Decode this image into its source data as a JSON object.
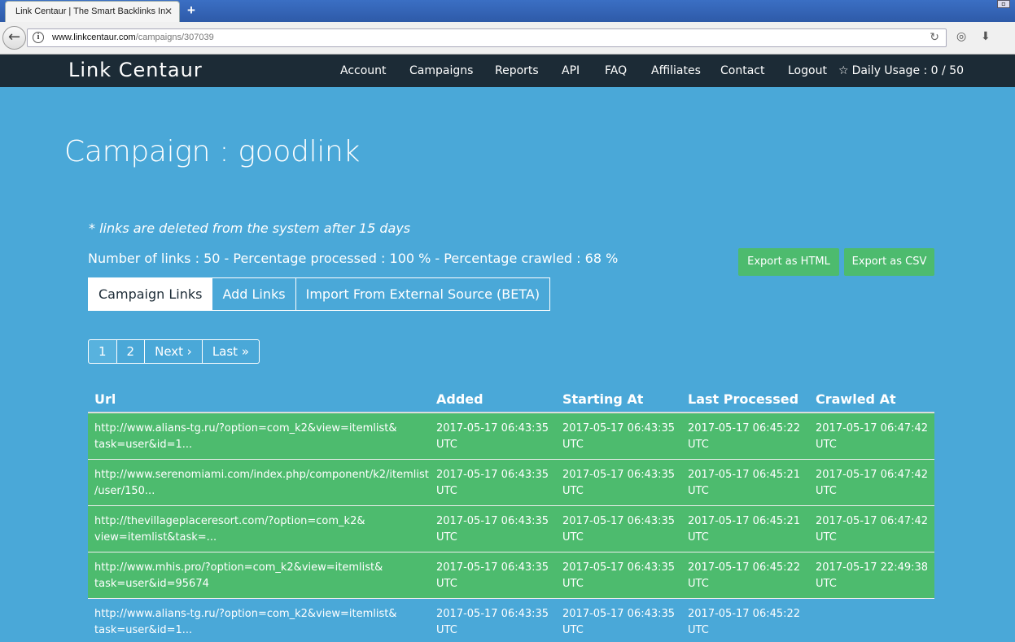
{
  "browser": {
    "tab_title": "Link Centaur | The Smart Backlinks In",
    "tab_close": "✕",
    "new_tab": "+",
    "url_host": "www.linkcentaur.com",
    "url_path": "/campaigns/307039"
  },
  "site": {
    "brand": "Link Centaur",
    "nav": [
      "Account",
      "Campaigns",
      "Reports",
      "API",
      "FAQ",
      "Affiliates",
      "Contact",
      "Logout"
    ],
    "daily_usage": "Daily Usage : 0 / 50"
  },
  "page": {
    "title": "Campaign : goodlink",
    "note": "* links are deleted from the system after 15 days",
    "stats": "Number of links : 50 - Percentage processed : 100 % - Percentage crawled : 68 %",
    "export_html": "Export as HTML",
    "export_csv": "Export as CSV",
    "tabs": [
      "Campaign Links",
      "Add Links",
      "Import From External Source (BETA)"
    ],
    "pagination": [
      "1",
      "2",
      "Next ›",
      "Last »"
    ]
  },
  "table": {
    "columns": [
      "Url",
      "Added",
      "Starting At",
      "Last Processed",
      "Crawled At"
    ],
    "rows": [
      {
        "url": [
          "http://www.alians-tg.ru/?option=com_k2&view=itemlist&",
          "task=user&id=1..."
        ],
        "added": [
          "2017-05-17 06:43:35",
          "UTC"
        ],
        "starting": [
          "2017-05-17 06:43:35",
          "UTC"
        ],
        "processed": [
          "2017-05-17 06:45:22",
          "UTC"
        ],
        "crawled": [
          "2017-05-17 06:47:42",
          "UTC"
        ]
      },
      {
        "url": [
          "http://www.serenomiami.com/index.php/component/k2/itemlist",
          "/user/150..."
        ],
        "added": [
          "2017-05-17 06:43:35",
          "UTC"
        ],
        "starting": [
          "2017-05-17 06:43:35",
          "UTC"
        ],
        "processed": [
          "2017-05-17 06:45:21",
          "UTC"
        ],
        "crawled": [
          "2017-05-17 06:47:42",
          "UTC"
        ]
      },
      {
        "url": [
          "http://thevillageplaceresort.com/?option=com_k2&",
          "view=itemlist&task=..."
        ],
        "added": [
          "2017-05-17 06:43:35",
          "UTC"
        ],
        "starting": [
          "2017-05-17 06:43:35",
          "UTC"
        ],
        "processed": [
          "2017-05-17 06:45:21",
          "UTC"
        ],
        "crawled": [
          "2017-05-17 06:47:42",
          "UTC"
        ]
      },
      {
        "url": [
          "http://www.mhis.pro/?option=com_k2&view=itemlist&",
          "task=user&id=95674"
        ],
        "added": [
          "2017-05-17 06:43:35",
          "UTC"
        ],
        "starting": [
          "2017-05-17 06:43:35",
          "UTC"
        ],
        "processed": [
          "2017-05-17 06:45:22",
          "UTC"
        ],
        "crawled": [
          "2017-05-17 22:49:38",
          "UTC"
        ]
      },
      {
        "url": [
          "http://www.alians-tg.ru/?option=com_k2&view=itemlist&",
          "task=user&id=1..."
        ],
        "added": [
          "2017-05-17 06:43:35",
          "UTC"
        ],
        "starting": [
          "2017-05-17 06:43:35",
          "UTC"
        ],
        "processed": [
          "2017-05-17 06:45:22",
          "UTC"
        ],
        "crawled": [
          "",
          ""
        ]
      }
    ]
  },
  "colors": {
    "page_bg": "#4aa8d8",
    "navbar_bg": "#1c2b36",
    "success_green": "#4dbb6e"
  }
}
